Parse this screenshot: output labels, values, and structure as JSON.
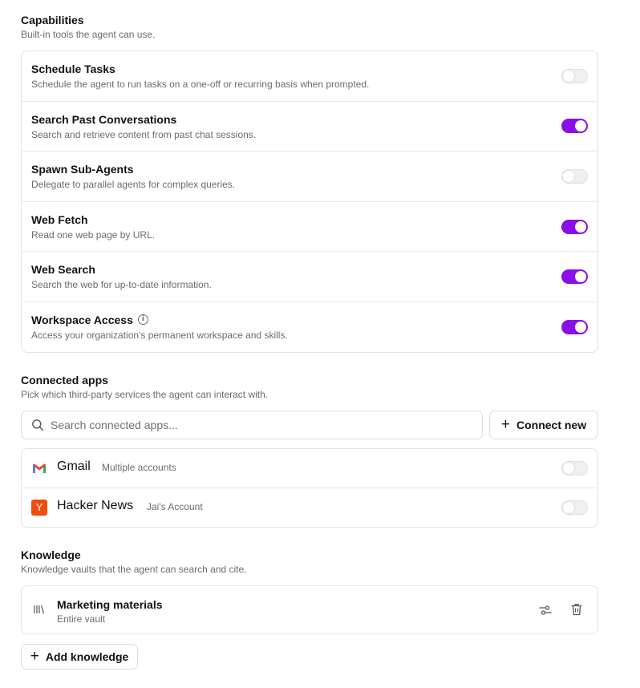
{
  "capabilities": {
    "title": "Capabilities",
    "subtitle": "Built-in tools the agent can use.",
    "items": [
      {
        "label": "Schedule Tasks",
        "description": "Schedule the agent to run tasks on a one-off or recurring basis when prompted.",
        "enabled": false
      },
      {
        "label": "Search Past Conversations",
        "description": "Search and retrieve content from past chat sessions.",
        "enabled": true
      },
      {
        "label": "Spawn Sub-Agents",
        "description": "Delegate to parallel agents for complex queries.",
        "enabled": false
      },
      {
        "label": "Web Fetch",
        "description": "Read one web page by URL.",
        "enabled": true
      },
      {
        "label": "Web Search",
        "description": "Search the web for up-to-date information.",
        "enabled": true
      },
      {
        "label": "Workspace Access",
        "description": "Access your organization's permanent workspace and skills.",
        "enabled": true,
        "info_icon": "info-icon"
      }
    ]
  },
  "connected_apps": {
    "title": "Connected apps",
    "subtitle": "Pick which third-party services the agent can interact with.",
    "search_placeholder": "Search connected apps...",
    "search_value": "",
    "connect_label": "Connect new",
    "apps": [
      {
        "name": "Gmail",
        "account": "Multiple accounts",
        "icon": "gmail-icon",
        "enabled": false
      },
      {
        "name": "Hacker News",
        "account": "Jai's Account",
        "icon": "hacker-news-icon",
        "logo_letter": "Y",
        "enabled": false
      }
    ]
  },
  "knowledge": {
    "title": "Knowledge",
    "subtitle": "Knowledge vaults that the agent can search and cite.",
    "vaults": [
      {
        "name": "Marketing materials",
        "scope": "Entire vault",
        "icon": "library-icon"
      }
    ],
    "add_label": "Add knowledge"
  },
  "colors": {
    "toggle_on": "#8a0ee6",
    "toggle_off": "#efefef",
    "hacker_news": "#f04c0c"
  }
}
